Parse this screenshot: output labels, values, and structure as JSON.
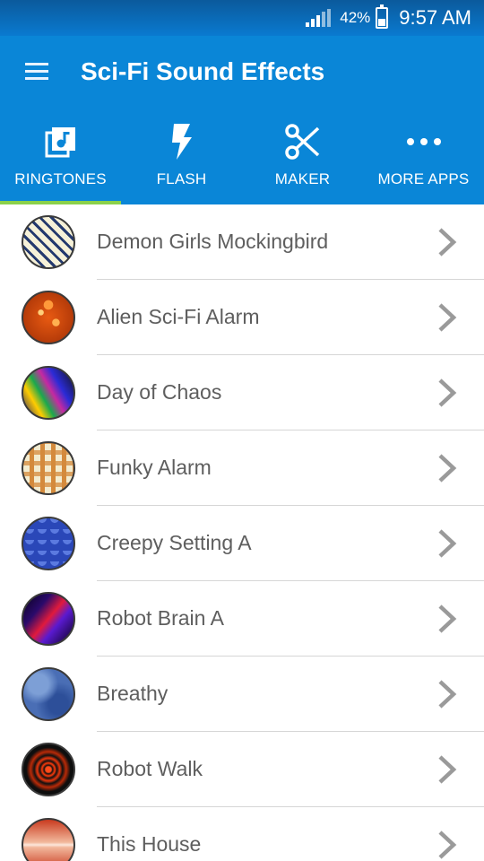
{
  "status_bar": {
    "battery_percent": "42%",
    "time": "9:57 AM"
  },
  "app_bar": {
    "title": "Sci-Fi Sound Effects",
    "background_color": "#0a86d7"
  },
  "tabs": [
    {
      "label": "RINGTONES",
      "icon": "ringtone-note-icon",
      "selected": true
    },
    {
      "label": "FLASH",
      "icon": "flash-bolt-icon",
      "selected": false
    },
    {
      "label": "MAKER",
      "icon": "scissors-icon",
      "selected": false
    },
    {
      "label": "MORE APPS",
      "icon": "more-dots-icon",
      "selected": false
    }
  ],
  "tab_indicator_color": "#8bd14a",
  "ringtones": [
    {
      "label": "Demon Girls Mockingbird"
    },
    {
      "label": "Alien Sci-Fi Alarm"
    },
    {
      "label": "Day of Chaos"
    },
    {
      "label": "Funky Alarm"
    },
    {
      "label": "Creepy Setting A"
    },
    {
      "label": "Robot Brain A"
    },
    {
      "label": "Breathy"
    },
    {
      "label": "Robot Walk"
    },
    {
      "label": "This House"
    }
  ]
}
